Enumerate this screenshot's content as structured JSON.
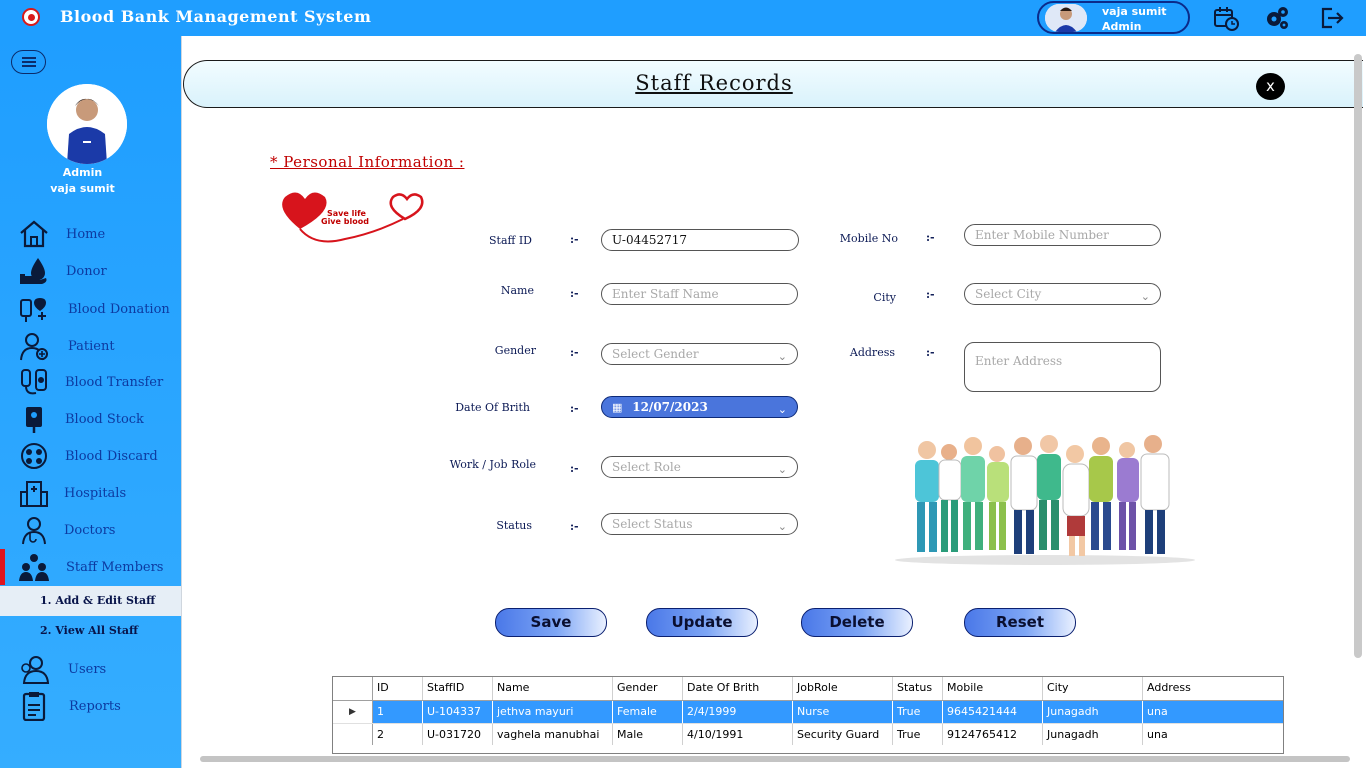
{
  "app": {
    "title": "Blood Bank Management System"
  },
  "user_chip": {
    "name": "vaja sumit",
    "role": "Admin"
  },
  "top_icons": [
    "calendar-clock-icon",
    "settings-gears-icon",
    "logout-icon"
  ],
  "sidebar": {
    "role": "Admin",
    "user": "vaja sumit",
    "items": [
      {
        "label": "Home",
        "icon": "home-icon"
      },
      {
        "label": "Donor",
        "icon": "donor-icon"
      },
      {
        "label": "Blood Donation",
        "icon": "blood-donation-icon"
      },
      {
        "label": "Patient",
        "icon": "patient-icon"
      },
      {
        "label": "Blood Transfer",
        "icon": "blood-transfer-icon"
      },
      {
        "label": "Blood Stock",
        "icon": "blood-stock-icon"
      },
      {
        "label": "Blood Discard",
        "icon": "blood-discard-icon"
      },
      {
        "label": "Hospitals",
        "icon": "hospital-icon"
      },
      {
        "label": "Doctors",
        "icon": "doctor-icon"
      },
      {
        "label": "Staff Members",
        "icon": "staff-members-icon"
      },
      {
        "label": "Users",
        "icon": "users-icon"
      },
      {
        "label": "Reports",
        "icon": "reports-icon"
      }
    ],
    "sub_items": [
      {
        "label": "1.  Add & Edit Staff"
      },
      {
        "label": "2.  View All Staff"
      }
    ]
  },
  "header": {
    "title": "Staff Records",
    "close_label": "x"
  },
  "form": {
    "section_title": "*  Personal Information  :",
    "logo_text_line1": "Save life",
    "logo_text_line2": "Give blood",
    "colon": ":-",
    "staff_id": {
      "label": "Staff ID",
      "value": "U-04452717"
    },
    "name": {
      "label": "Name",
      "placeholder": "Enter Staff Name"
    },
    "gender": {
      "label": "Gender",
      "placeholder": "Select Gender"
    },
    "dob": {
      "label": "Date Of Brith",
      "value": "12/07/2023"
    },
    "role": {
      "label": "Work / Job Role",
      "placeholder": "Select Role"
    },
    "status": {
      "label": "Status",
      "placeholder": "Select Status"
    },
    "mobile": {
      "label": "Mobile No",
      "placeholder": "Enter Mobile Number"
    },
    "city": {
      "label": "City",
      "placeholder": "Select City"
    },
    "address": {
      "label": "Address",
      "placeholder": "Enter Address"
    }
  },
  "actions": {
    "save": "Save",
    "update": "Update",
    "delete": "Delete",
    "reset": "Reset"
  },
  "grid": {
    "columns": [
      "ID",
      "StaffID",
      "Name",
      "Gender",
      "Date Of Brith",
      "JobRole",
      "Status",
      "Mobile",
      "City",
      "Address"
    ],
    "rows": [
      [
        "1",
        "U-104337",
        "jethva mayuri",
        "Female",
        "2/4/1999",
        "Nurse",
        "True",
        "9645421444",
        "Junagadh",
        "una"
      ],
      [
        "2",
        "U-031720",
        "vaghela manubhai",
        "Male",
        "4/10/1991",
        "Security Guard",
        "True",
        "9124765412",
        "Junagadh",
        "una"
      ]
    ],
    "selected_row_marker": "▶"
  },
  "colors": {
    "titlebar": "#1f9eff",
    "nav_text": "#0d3aa0",
    "active_marker": "#e0141e",
    "selected_row": "#3399ff",
    "section_title": "#c00000"
  }
}
